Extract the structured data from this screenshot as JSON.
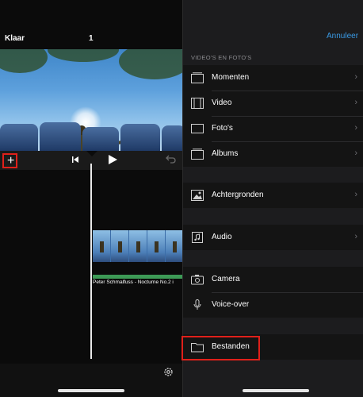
{
  "left": {
    "done_label": "Klaar",
    "clip_count": "1",
    "audio_title": "Peter Schmalfuss - Nocturne No.2 i"
  },
  "picker": {
    "cancel_label": "Annuleer",
    "section_title": "VIDEO'S EN FOTO'S",
    "items": [
      {
        "label": "Momenten",
        "icon": "moments-icon",
        "chevron": true
      },
      {
        "label": "Video",
        "icon": "film-icon",
        "chevron": true
      },
      {
        "label": "Foto's",
        "icon": "photos-icon",
        "chevron": true
      },
      {
        "label": "Albums",
        "icon": "albums-icon",
        "chevron": true
      },
      {
        "label": "Achtergronden",
        "icon": "backgrounds-icon",
        "chevron": true
      },
      {
        "label": "Audio",
        "icon": "audio-icon",
        "chevron": true
      },
      {
        "label": "Camera",
        "icon": "camera-icon",
        "chevron": false
      },
      {
        "label": "Voice-over",
        "icon": "microphone-icon",
        "chevron": false
      },
      {
        "label": "Bestanden",
        "icon": "folder-icon",
        "chevron": false
      }
    ]
  },
  "colors": {
    "accent": "#3a9be6",
    "highlight": "#e0201a",
    "audio_track": "#3d9a56"
  }
}
